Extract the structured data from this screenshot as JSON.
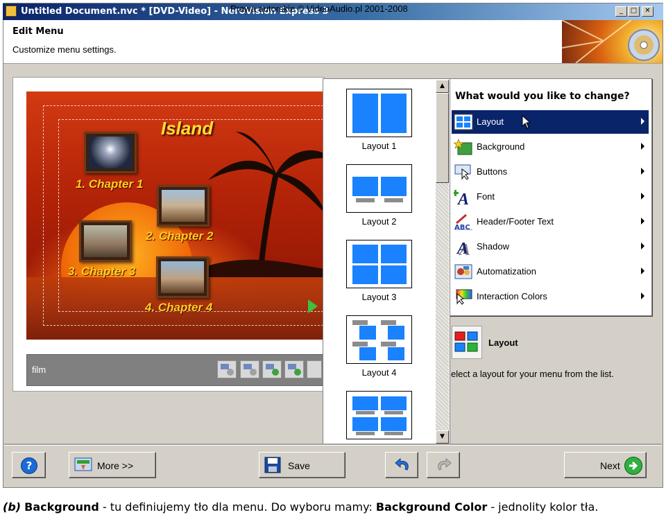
{
  "window": {
    "title": "Untitled Document.nvc * [DVD-Video] - NeroVision Express 3",
    "watermark": "Prawa autorskie © VideoAudio.pl 2001-2008",
    "controls": [
      "_",
      "□",
      "✕"
    ]
  },
  "header": {
    "title": "Edit Menu",
    "subtitle": "Customize menu settings."
  },
  "preview": {
    "menu_title": "Island",
    "chapters": [
      "1. Chapter 1",
      "2. Chapter 2",
      "3. Chapter 3",
      "4. Chapter 4"
    ],
    "film_label": "film"
  },
  "layouts": [
    "Layout 1",
    "Layout 2",
    "Layout 3",
    "Layout 4"
  ],
  "menu": {
    "heading": "What would you like to change?",
    "items": [
      {
        "label": "Layout",
        "icon": "layout-icon",
        "selected": true
      },
      {
        "label": "Background",
        "icon": "background-icon"
      },
      {
        "label": "Buttons",
        "icon": "buttons-icon"
      },
      {
        "label": "Font",
        "icon": "font-icon"
      },
      {
        "label": "Header/Footer Text",
        "icon": "header-footer-icon"
      },
      {
        "label": "Shadow",
        "icon": "shadow-icon"
      },
      {
        "label": "Automatization",
        "icon": "automatization-icon"
      },
      {
        "label": "Interaction Colors",
        "icon": "interaction-colors-icon"
      }
    ]
  },
  "description": {
    "title": "Layout",
    "text": "elect a layout for your menu from the list."
  },
  "buttons": {
    "help": "?",
    "more": "More >>",
    "save": "Save",
    "next": "Next"
  },
  "caption": {
    "prefix": "(b)",
    "bold1": "Background",
    "text1": " - tu definiujemy tło dla menu. Do wyboru mamy: ",
    "bold2": "Background Color",
    "text2": " - jednolity kolor tła."
  },
  "colors": {
    "selection": "#0a246a",
    "layout_blue": "#1a82ff",
    "window_bg": "#d4d0c8"
  }
}
